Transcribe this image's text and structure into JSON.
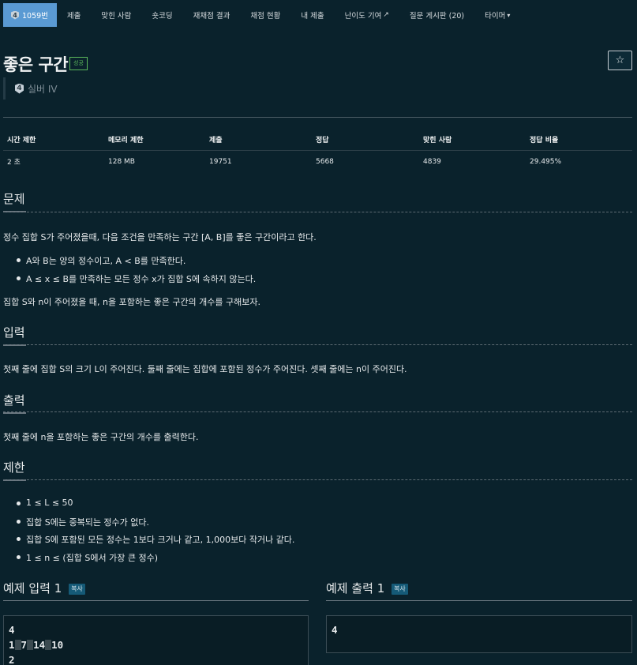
{
  "nav": {
    "problem_tab": {
      "tier": "4",
      "label": "1059번"
    },
    "tabs": [
      "제출",
      "맞힌 사람",
      "숏코딩",
      "재채점 결과",
      "채점 현황",
      "내 제출"
    ],
    "contribute_label": "난이도 기여",
    "board_label": "질문 게시판 (20)",
    "timer_label": "타이머"
  },
  "problem": {
    "title": "좋은 구간",
    "status": "성공",
    "star": "☆",
    "tier_number": "4",
    "tier_name": "실버 IV"
  },
  "info_table": {
    "headers": [
      "시간 제한",
      "메모리 제한",
      "제출",
      "정답",
      "맞힌 사람",
      "정답 비율"
    ],
    "values": [
      "2 초",
      "128 MB",
      "19751",
      "5668",
      "4839",
      "29.495%"
    ]
  },
  "sections": {
    "description": {
      "heading": "문제",
      "intro": "정수 집합 S가 주어졌을때, 다음 조건을 만족하는 구간 [A, B]를 좋은 구간이라고 한다.",
      "bullets": [
        "A와 B는 양의 정수이고, A < B를 만족한다.",
        "A ≤ x ≤ B를 만족하는 모든 정수 x가 집합 S에 속하지 않는다."
      ],
      "outro": "집합 S와 n이 주어졌을 때, n을 포함하는 좋은 구간의 개수를 구해보자."
    },
    "input": {
      "heading": "입력",
      "text": "첫째 줄에 집합 S의 크기 L이 주어진다. 둘째 줄에는 집합에 포함된 정수가 주어진다. 셋째 줄에는 n이 주어진다."
    },
    "output": {
      "heading": "출력",
      "text": "첫째 줄에 n을 포함하는 좋은 구간의 개수를 출력한다."
    },
    "limits": {
      "heading": "제한",
      "bullets": [
        "1 ≤ L ≤ 50",
        "집합 S에는 중복되는 정수가 없다.",
        "집합 S에 포함된 모든 정수는 1보다 크거나 같고, 1,000보다 작거나 같다.",
        "1 ≤ n ≤ (집합 S에서 가장 큰 정수)"
      ]
    }
  },
  "samples": {
    "copy_label": "복사",
    "input_heading": "예제 입력 1",
    "output_heading": "예제 출력 1",
    "input_lines": [
      "4",
      "2",
      "1",
      "7",
      "14",
      "10"
    ],
    "output_lines": [
      "4"
    ]
  }
}
